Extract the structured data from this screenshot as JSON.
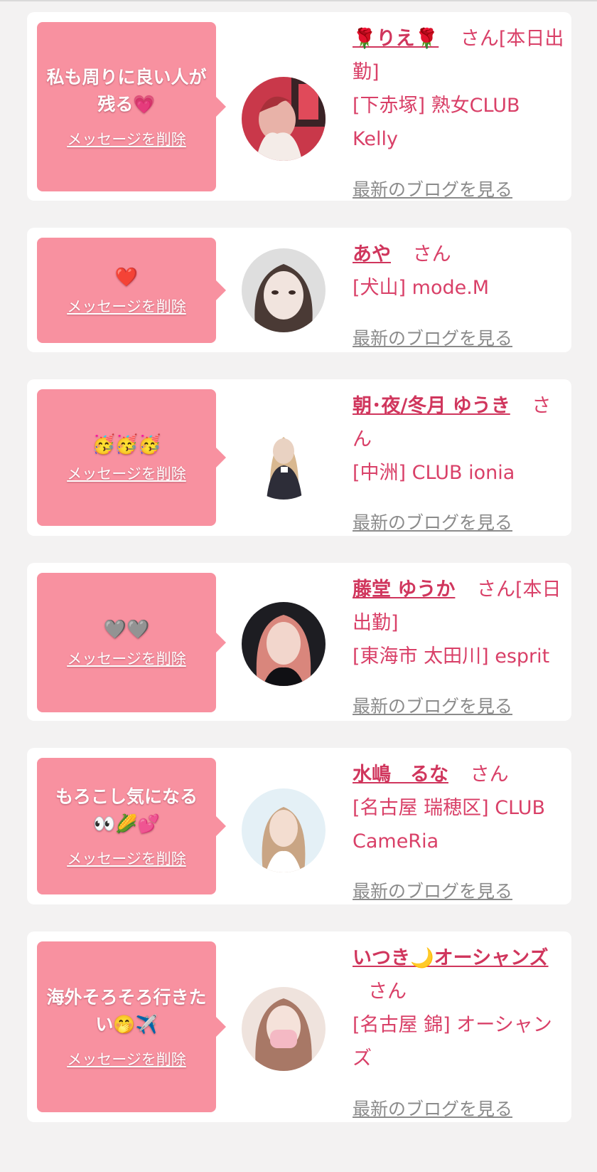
{
  "cards": [
    {
      "message": "私も周りに良い人が残る💗",
      "delete_label": "メッセージを削除",
      "name": "🌹りえ🌹",
      "suffix": "さん[本日出勤]",
      "shop": "[下赤塚] 熟女CLUB Kelly",
      "blog_label": "最新のブログを見る",
      "avatar_colors": [
        "#c9384a",
        "#e8b2a8",
        "#3a2326"
      ]
    },
    {
      "message": "❤️",
      "delete_label": "メッセージを削除",
      "name": "あや",
      "suffix": "さん",
      "shop": "[犬山] mode.M",
      "blog_label": "最新のブログを見る",
      "avatar_colors": [
        "#dedede",
        "#f1e4de",
        "#4a3a35"
      ]
    },
    {
      "message": "🥳🥳🥳",
      "delete_label": "メッセージを削除",
      "name": "朝･夜/冬月 ゆうき",
      "suffix": "さん",
      "shop": "[中洲] CLUB ionia",
      "blog_label": "最新のブログを見る",
      "avatar_colors": [
        "#ffffff",
        "#e9d2c2",
        "#2d2d38"
      ]
    },
    {
      "message": "🩶🩶",
      "delete_label": "メッセージを削除",
      "name": "藤堂 ゆうか",
      "suffix": "さん[本日出勤]",
      "shop": "[東海市 太田川] esprit",
      "blog_label": "最新のブログを見る",
      "avatar_colors": [
        "#1d1d22",
        "#e9a49a",
        "#101014"
      ]
    },
    {
      "message": "もろこし気になる👀🌽💕",
      "delete_label": "メッセージを削除",
      "name": "水嶋　るな",
      "suffix": "さん",
      "shop": "[名古屋 瑞穂区] CLUB CameRia",
      "blog_label": "最新のブログを見る",
      "avatar_colors": [
        "#e4f0f6",
        "#f3ddd0",
        "#c9a584"
      ]
    },
    {
      "message": "海外そろそろ行きたい🤭✈️",
      "delete_label": "メッセージを削除",
      "name": "いつき🌙オーシャンズ",
      "suffix": "さん",
      "shop": "[名古屋 錦] オーシャンズ",
      "blog_label": "最新のブログを見る",
      "avatar_colors": [
        "#efe3dd",
        "#f4b9c4",
        "#a87866"
      ]
    }
  ]
}
